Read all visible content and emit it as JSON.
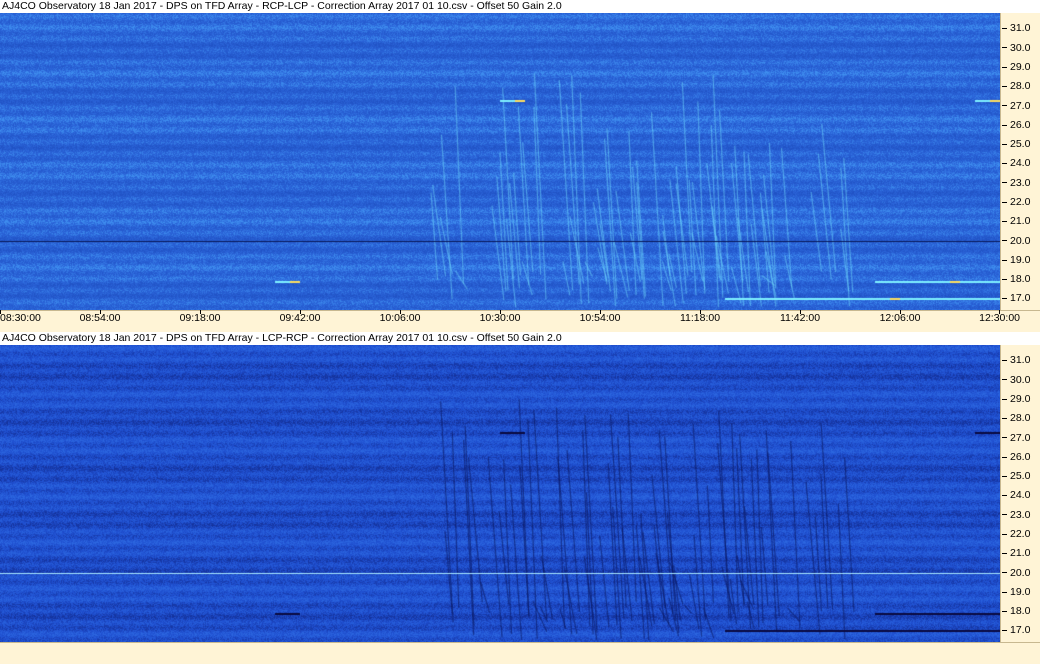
{
  "panels": [
    {
      "title": "AJ4CO Observatory 18 Jan 2017  -  DPS on TFD Array  -  RCP-LCP  -  Correction Array 2017 01 10.csv  -  Offset 50  Gain 2.0",
      "polarity": "RCP-LCP",
      "colors": {
        "base": "#2a63d8",
        "light": "#3f8ff0",
        "dark": "#1a47b8",
        "bright": "#7ff0ff",
        "hot": "#ffe060",
        "axis_bg": "#fff4d6"
      },
      "show_time_labels": true
    },
    {
      "title": "AJ4CO Observatory 18 Jan 2017  -  DPS on TFD Array  -  LCP-RCP  -  Correction Array 2017 01 10.csv  -  Offset 50  Gain 2.0",
      "polarity": "LCP-RCP",
      "colors": {
        "base": "#1f4fd0",
        "light": "#2c67e0",
        "dark": "#0d1f7a",
        "bright": "#6fd8ff",
        "hot": "#0a0a40",
        "axis_bg": "#fff4d6"
      },
      "show_time_labels": false
    }
  ],
  "chart_data": {
    "type": "heatmap",
    "title": "AJ4CO Observatory 18 Jan 2017  -  DPS on TFD Array",
    "x_ticks": [
      "08:30:00",
      "08:54:00",
      "09:18:00",
      "09:42:00",
      "10:06:00",
      "10:30:00",
      "10:54:00",
      "11:18:00",
      "11:42:00",
      "12:06:00",
      "12:30:00"
    ],
    "x_range": [
      "08:30:00",
      "12:30:00"
    ],
    "y_ticks": [
      "31.0",
      "30.0",
      "29.0",
      "28.0",
      "27.0",
      "26.0",
      "25.0",
      "24.0",
      "23.0",
      "22.0",
      "21.0",
      "20.0",
      "19.0",
      "18.0",
      "17.0"
    ],
    "y_range": [
      16.4,
      31.8
    ],
    "series": [
      {
        "name": "RCP-LCP"
      },
      {
        "name": "LCP-RCP"
      }
    ],
    "features": {
      "horizontal_line_freq": 20.0,
      "persistent_bands": [
        {
          "freq": 27.3,
          "start": "10:30:00",
          "end": "10:36:00"
        },
        {
          "freq": 27.3,
          "start": "12:24:00",
          "end": "12:30:00"
        },
        {
          "freq": 17.9,
          "start": "09:36:00",
          "end": "09:42:00"
        },
        {
          "freq": 17.0,
          "start": "11:24:00",
          "end": "12:30:00"
        },
        {
          "freq": 17.9,
          "start": "12:00:00",
          "end": "12:30:00"
        }
      ],
      "burst_times": [
        "10:18:00",
        "10:30:00",
        "10:36:00",
        "10:48:00",
        "10:54:00",
        "11:00:00",
        "11:06:00",
        "11:12:00",
        "11:18:00",
        "11:24:00",
        "11:30:00",
        "11:36:00",
        "11:48:00"
      ]
    }
  }
}
